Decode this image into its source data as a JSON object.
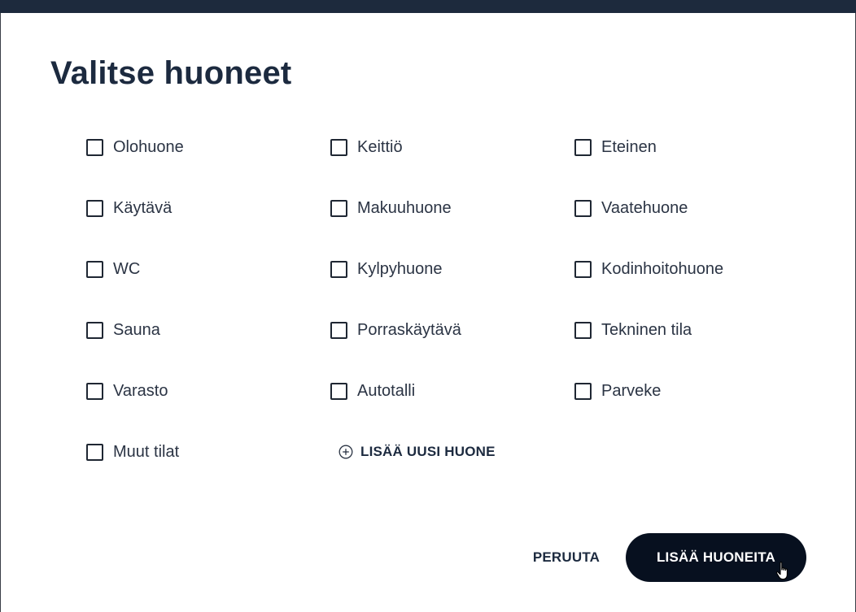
{
  "dialog": {
    "title": "Valitse huoneet",
    "rooms": [
      {
        "label": "Olohuone",
        "checked": false
      },
      {
        "label": "Keittiö",
        "checked": false
      },
      {
        "label": "Eteinen",
        "checked": false
      },
      {
        "label": "Käytävä",
        "checked": false
      },
      {
        "label": "Makuuhuone",
        "checked": false
      },
      {
        "label": "Vaatehuone",
        "checked": false
      },
      {
        "label": "WC",
        "checked": false
      },
      {
        "label": "Kylpyhuone",
        "checked": false
      },
      {
        "label": "Kodinhoitohuone",
        "checked": false
      },
      {
        "label": "Sauna",
        "checked": false
      },
      {
        "label": "Porraskäytävä",
        "checked": false
      },
      {
        "label": "Tekninen tila",
        "checked": false
      },
      {
        "label": "Varasto",
        "checked": false
      },
      {
        "label": "Autotalli",
        "checked": false
      },
      {
        "label": "Parveke",
        "checked": false
      },
      {
        "label": "Muut tilat",
        "checked": false
      }
    ],
    "add_room_label": "LISÄÄ UUSI HUONE",
    "add_room_icon": "plus-circle-icon",
    "cancel_label": "PERUUTA",
    "submit_label": "LISÄÄ HUONEITA"
  },
  "colors": {
    "top_bar": "#1d2a3d",
    "text": "#1c2a3f",
    "submit_bg": "#07101f",
    "submit_text": "#ffffff"
  }
}
